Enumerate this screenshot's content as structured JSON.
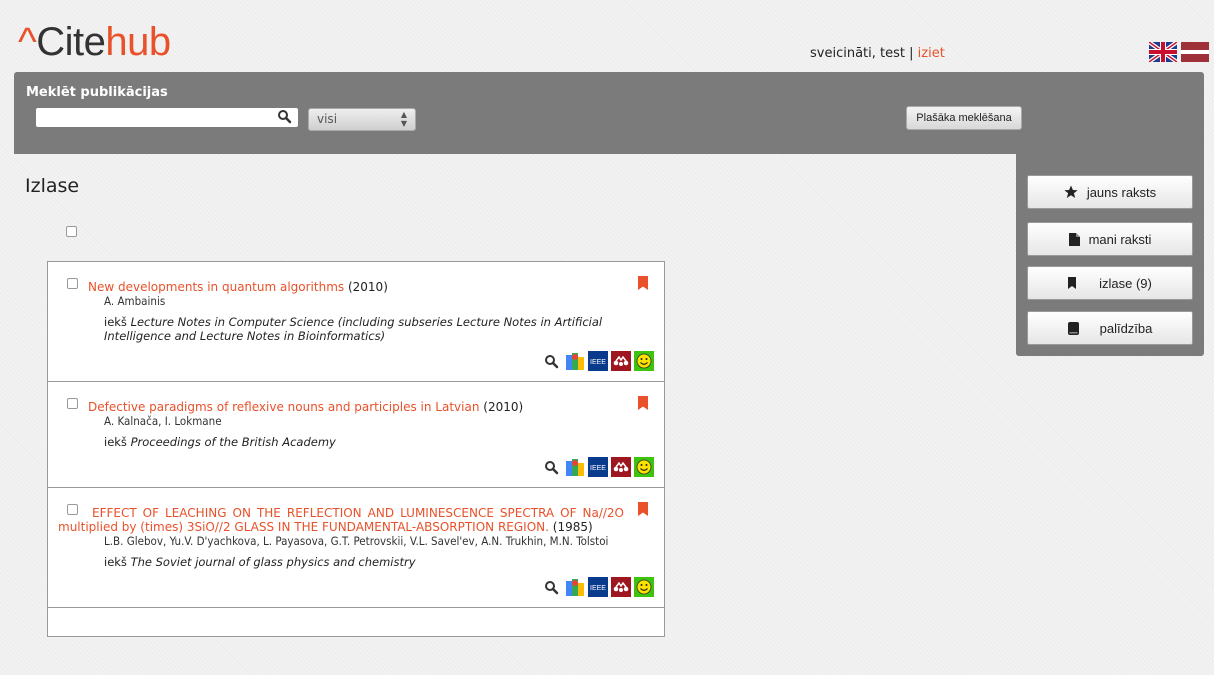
{
  "brand": {
    "caret": "^",
    "cite": "Cite",
    "hub": "hub"
  },
  "header": {
    "greeting": "sveicināti, test",
    "separator": "|",
    "logout": "iziet"
  },
  "search": {
    "title": "Meklēt publikācijas",
    "value": "",
    "placeholder": "",
    "scope": "visi",
    "advanced_label": "Plašāka meklēšana"
  },
  "sidebar": {
    "items": [
      {
        "label": "jauns raksts",
        "icon": "star-icon"
      },
      {
        "label": "mani raksti",
        "icon": "document-icon"
      },
      {
        "label": "izlase (9)",
        "icon": "bookmark-icon"
      },
      {
        "label": "palīdzība",
        "icon": "book-icon"
      }
    ]
  },
  "main": {
    "title": "Izlase",
    "publications": [
      {
        "title": "New developments in quantum algorithms",
        "year": "(2010)",
        "authors": "A. Ambainis",
        "venue_prefix": "iekš",
        "venue": "Lecture Notes in Computer Science (including subseries Lecture Notes in Artificial Intelligence and Lecture Notes in Bioinformatics)"
      },
      {
        "title": "Defective paradigms of reflexive nouns and participles in Latvian",
        "year": "(2010)",
        "authors": "A. Kalnača, I. Lokmane",
        "venue_prefix": "iekš",
        "venue": "Proceedings of the British Academy"
      },
      {
        "title": "EFFECT OF LEACHING ON THE REFLECTION AND LUMINESCENCE SPECTRA OF Na//2O multiplied by (times) 3SiO//2 GLASS IN THE FUNDAMENTAL-ABSORPTION REGION.",
        "year": "(1985)",
        "authors": "L.B. Glebov, Yu.V. D'yachkova, L. Payasova, G.T. Petrovskii, V.L. Savel'ev, A.N. Trukhin, M.N. Tolstoi",
        "venue_prefix": "iekš",
        "venue": "The Soviet journal of glass physics and chemistry"
      }
    ],
    "link_icons": [
      "search-icon",
      "google-scholar-icon",
      "ieee-icon",
      "mendeley-icon",
      "citeulike-icon"
    ],
    "ieee_text": "IEEE"
  },
  "colors": {
    "accent": "#e8512a",
    "bar": "#7b7b7b"
  }
}
